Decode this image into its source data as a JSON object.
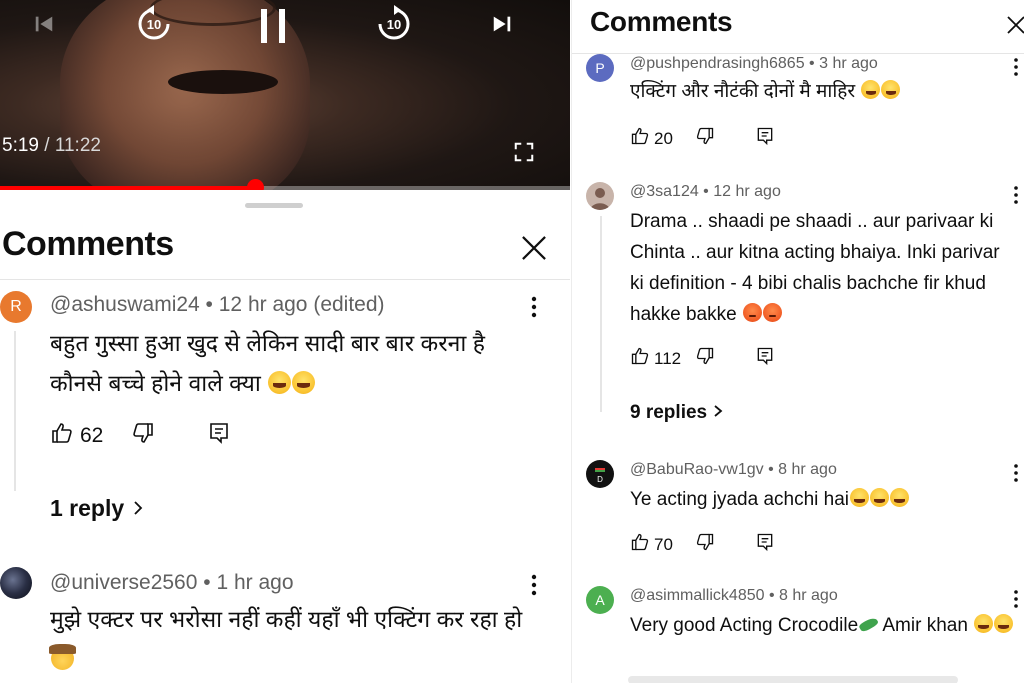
{
  "left_panel": {
    "player": {
      "current_time": "5:19",
      "duration": "11:22",
      "time_separator": "/",
      "progress_fraction": 0.447,
      "icons": {
        "previous": "skip-previous-icon",
        "rewind": "rewind-10-icon",
        "pause": "pause-icon",
        "forward": "forward-10-icon",
        "next": "skip-next-icon",
        "fullscreen": "fullscreen-icon"
      },
      "rewind_seconds": "10",
      "forward_seconds": "10"
    },
    "title": "Comments",
    "comments": [
      {
        "avatar_letter": "R",
        "avatar_color": "#e8792e",
        "author": "@ashuswami24",
        "time": "12 hr ago (edited)",
        "text": "बहुत गुस्सा हुआ खुद से लेकिन सादी बार बार करना है कौनसे बच्चे होने वाले क्या",
        "emojis": [
          "laugh",
          "laugh"
        ],
        "likes": "62",
        "replies_label": "1 reply"
      },
      {
        "avatar_letter": "",
        "avatar_color": "#1b1e2a",
        "author": "@universe2560",
        "time": "1 hr ago",
        "text": "मुझे एक्टर पर भरोसा नहीं कहीं यहाँ भी एक्टिंग कर रहा हो",
        "emojis": [
          "cowboy"
        ]
      }
    ]
  },
  "right_panel": {
    "title": "Comments",
    "comments": [
      {
        "avatar_letter": "P",
        "avatar_color": "#5c6bc0",
        "author": "@pushpendrasingh6865",
        "time": "3 hr ago",
        "text": "एक्टिंग और नौटंकी दोनों मै माहिर",
        "emojis": [
          "laugh",
          "laugh"
        ],
        "likes": "20"
      },
      {
        "avatar_letter": "",
        "avatar_color": "#a88a7c",
        "author": "@3sa124",
        "time": "12 hr ago",
        "text": "Drama .. shaadi pe shaadi .. aur parivaar ki Chinta .. aur kitna acting bhaiya. Inki parivar ki definition - 4 bibi chalis bachche fir khud hakke bakke",
        "emojis": [
          "angry",
          "angry"
        ],
        "likes": "112",
        "replies_label": "9 replies"
      },
      {
        "avatar_letter": "D",
        "avatar_color": "#111111",
        "author": "@BabuRao-vw1gv",
        "time": "8 hr ago",
        "text": "Ye acting jyada achchi hai",
        "emojis": [
          "laugh",
          "laugh",
          "laugh"
        ],
        "likes": "70"
      },
      {
        "avatar_letter": "A",
        "avatar_color": "#4caf50",
        "author": "@asimmallick4850",
        "time": "8 hr ago",
        "text": "Very good Acting Crocodile",
        "text_after": " Amir khan",
        "emojis": [
          "croc"
        ],
        "emojis_after": [
          "laugh",
          "laugh"
        ]
      }
    ]
  },
  "icons": {
    "close": "close-icon",
    "more": "more-vertical-icon",
    "like": "thumbs-up-icon",
    "dislike": "thumbs-down-icon",
    "reply": "reply-comment-icon",
    "chevron": "chevron-right-icon"
  }
}
